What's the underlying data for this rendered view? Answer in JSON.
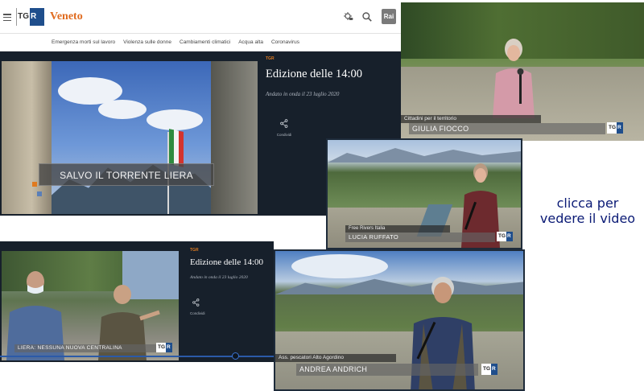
{
  "header": {
    "region": "Veneto",
    "tgr_logo_left": "TG",
    "tgr_logo_right": "R",
    "rai_logo": "Rai"
  },
  "nav": {
    "items": [
      "Emergenza morti sul lavoro",
      "Violenza sulle donne",
      "Cambiamenti climatici",
      "Acqua alta",
      "Coronavirus"
    ]
  },
  "video_main": {
    "caption": "SALVO IL TORRENTE LIERA"
  },
  "info": {
    "tag": "TGR",
    "title": "Edizione delle 14:00",
    "date": "Andato in onda il 23 luglio 2020",
    "share_label": "Condividi"
  },
  "frames": {
    "giulia": {
      "role": "Cittadini per il territorio",
      "name": "GIULIA FIOCCO"
    },
    "lucia": {
      "role": "Free Rivers Italia",
      "name": "LUCIA RUFFATO"
    },
    "liera": {
      "caption": "LIERA: NESSUNA NUOVA CENTRALINA"
    },
    "andrea": {
      "role": "Ass. pescatori Alto Agordino",
      "name": "ANDREA ANDRICH"
    }
  },
  "cta": {
    "line1": "clicca per",
    "line2": "vedere il video"
  },
  "colors": {
    "accent_orange": "#e06b1f",
    "dark_bg": "#17202b",
    "cta_text": "#0a1a75",
    "tgr_blue": "#1f4e8c"
  },
  "icons": [
    "menu-icon",
    "weather-icon",
    "search-icon",
    "share-icon"
  ]
}
